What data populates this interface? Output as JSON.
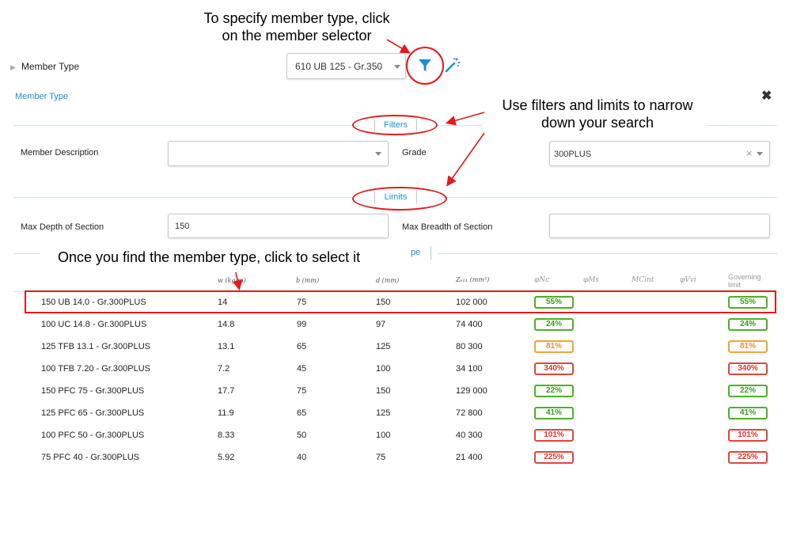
{
  "annotations": {
    "member_selector_line1": "To specify member type, click",
    "member_selector_line2": "on the member selector",
    "filters_line1": "Use filters and limits to narrow",
    "filters_line2": "down your search",
    "select_hint": "Once you find the member type, click to select it"
  },
  "header": {
    "member_type_label": "Member Type",
    "member_select_value": "610 UB 125 - Gr.350"
  },
  "panel": {
    "title": "Member Type",
    "close_icon": "close-icon",
    "filters_tab": "Filters",
    "limits_tab": "Limits",
    "type_tab_fragment": "pe",
    "member_description_label": "Member Description",
    "member_description_value": "",
    "grade_label": "Grade",
    "grade_value": "300PLUS",
    "max_depth_label": "Max Depth of Section",
    "max_depth_value": "150",
    "max_breadth_label": "Max Breadth of Section",
    "max_breadth_value": ""
  },
  "table": {
    "headers": {
      "w": "w (kg/m)",
      "b": "b (mm)",
      "d": "d (mm)",
      "z": "Zₑ₁₁ (mm³)",
      "phiNc": "φNc",
      "phiMs": "φMs",
      "MCint": "MCint",
      "phiVvi": "φVvi",
      "governing": "Governing limit"
    },
    "rows": [
      {
        "name": "150 UB 14.0 - Gr.300PLUS",
        "w": "14",
        "b": "75",
        "d": "150",
        "z": "102 000",
        "nc": "55%",
        "gov": "55%",
        "status": "g"
      },
      {
        "name": "100 UC 14.8 - Gr.300PLUS",
        "w": "14.8",
        "b": "99",
        "d": "97",
        "z": "74 400",
        "nc": "24%",
        "gov": "24%",
        "status": "g"
      },
      {
        "name": "125 TFB 13.1 - Gr.300PLUS",
        "w": "13.1",
        "b": "65",
        "d": "125",
        "z": "80 300",
        "nc": "81%",
        "gov": "81%",
        "status": "o"
      },
      {
        "name": "100 TFB 7.20 - Gr.300PLUS",
        "w": "7.2",
        "b": "45",
        "d": "100",
        "z": "34 100",
        "nc": "340%",
        "gov": "340%",
        "status": "r"
      },
      {
        "name": "150 PFC 75 - Gr.300PLUS",
        "w": "17.7",
        "b": "75",
        "d": "150",
        "z": "129 000",
        "nc": "22%",
        "gov": "22%",
        "status": "g"
      },
      {
        "name": "125 PFC 65 - Gr.300PLUS",
        "w": "11.9",
        "b": "65",
        "d": "125",
        "z": "72 800",
        "nc": "41%",
        "gov": "41%",
        "status": "g"
      },
      {
        "name": "100 PFC 50 - Gr.300PLUS",
        "w": "8.33",
        "b": "50",
        "d": "100",
        "z": "40 300",
        "nc": "101%",
        "gov": "101%",
        "status": "r"
      },
      {
        "name": "75 PFC 40 - Gr.300PLUS",
        "w": "5.92",
        "b": "40",
        "d": "75",
        "z": "21 400",
        "nc": "225%",
        "gov": "225%",
        "status": "r"
      }
    ]
  },
  "colors": {
    "accent_blue": "#1a8fd6",
    "annotation_red": "#e21b1b",
    "ok_green": "#4caf2a",
    "warn_orange": "#f0a43a",
    "fail_red": "#e0463c"
  }
}
